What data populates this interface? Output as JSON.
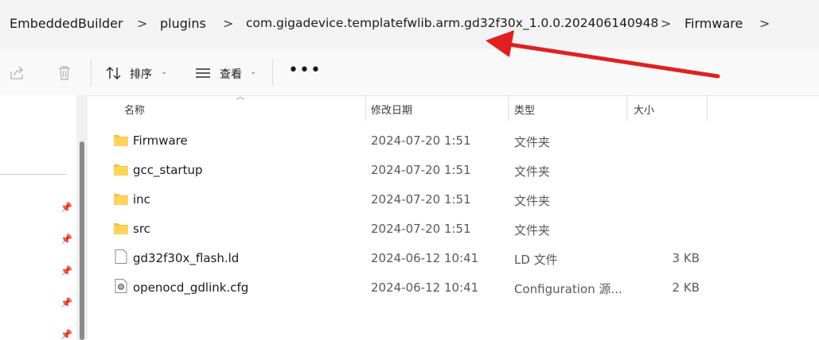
{
  "breadcrumb": {
    "items": [
      "EmbeddedBuilder",
      "plugins",
      "com.gigadevice.templatefwlib.arm.gd32f30x_1.0.0.202406140948",
      "Firmware"
    ],
    "separator": ">"
  },
  "toolbar": {
    "sort_label": "排序",
    "view_label": "查看",
    "more_label": "•••",
    "chevron": "⌄"
  },
  "columns": {
    "name": "名称",
    "date": "修改日期",
    "type": "类型",
    "size": "大小"
  },
  "files": [
    {
      "name": "Firmware",
      "date": "2024-07-20 1:51",
      "type": "文件夹",
      "size": "",
      "icon": "folder-icon"
    },
    {
      "name": "gcc_startup",
      "date": "2024-07-20 1:51",
      "type": "文件夹",
      "size": "",
      "icon": "folder-icon"
    },
    {
      "name": "inc",
      "date": "2024-07-20 1:51",
      "type": "文件夹",
      "size": "",
      "icon": "folder-icon"
    },
    {
      "name": "src",
      "date": "2024-07-20 1:51",
      "type": "文件夹",
      "size": "",
      "icon": "folder-icon"
    },
    {
      "name": "gd32f30x_flash.ld",
      "date": "2024-06-12 10:41",
      "type": "LD 文件",
      "size": "3 KB",
      "icon": "file-icon"
    },
    {
      "name": "openocd_gdlink.cfg",
      "date": "2024-06-12 10:41",
      "type": "Configuration 源...",
      "size": "2 KB",
      "icon": "config-file-icon"
    }
  ],
  "colors": {
    "folder": "#f5c242",
    "annotation_arrow": "#e02020"
  }
}
